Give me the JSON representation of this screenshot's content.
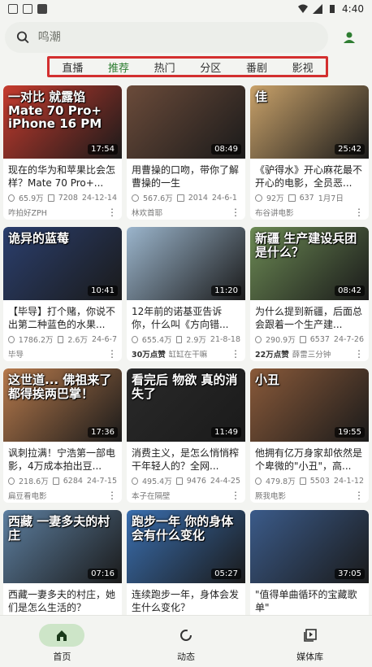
{
  "status": {
    "time": "4:40"
  },
  "search": {
    "placeholder": "鸣潮"
  },
  "tabs": [
    {
      "label": "直播",
      "active": false
    },
    {
      "label": "推荐",
      "active": true
    },
    {
      "label": "热门",
      "active": false
    },
    {
      "label": "分区",
      "active": false
    },
    {
      "label": "番剧",
      "active": false
    },
    {
      "label": "影视",
      "active": false
    }
  ],
  "videos": [
    {
      "overlay": "一对比 就露馅 Mate 70 Pro+ iPhone 16 PM",
      "duration": "17:54",
      "title": "现在的华为和苹果比会怎样？Mate 70 Pro+...",
      "views": "65.9万",
      "danmaku": "7208",
      "date": "24-12-14",
      "likes": "",
      "author": "咋拍好ZPH",
      "color": "#c63b2e"
    },
    {
      "overlay": "",
      "duration": "08:49",
      "title": "用曹操的口吻，带你了解曹操的一生",
      "views": "567.6万",
      "danmaku": "2014",
      "date": "24-6-1",
      "likes": "",
      "author": "林欢首耶",
      "color": "#6b4b3a"
    },
    {
      "overlay": "佳",
      "duration": "25:42",
      "title": "《驴得水》开心麻花最不开心的电影，全员恶...",
      "views": "92万",
      "danmaku": "637",
      "date": "1月7日",
      "likes": "",
      "author": "布谷讲电影",
      "color": "#c9a26a"
    },
    {
      "overlay": "诡异的蓝莓",
      "duration": "10:41",
      "title": "【毕导】打个赌，你说不出第二种蓝色的水果...",
      "views": "1786.2万",
      "danmaku": "2.6万",
      "date": "24-6-7",
      "likes": "",
      "author": "毕导",
      "color": "#2b3f6e"
    },
    {
      "overlay": "",
      "duration": "11:20",
      "title": "12年前的诺基亚告诉你，什么叫《方向错...",
      "views": "655.4万",
      "danmaku": "2.9万",
      "date": "21-8-18",
      "likes": "30万点赞",
      "author": "缸缸在干嘛",
      "color": "#9bb5cc"
    },
    {
      "overlay": "新疆 生产建设兵团 是什么？",
      "duration": "08:42",
      "title": "为什么提到新疆，后面总会跟着一个生产建...",
      "views": "290.9万",
      "danmaku": "6537",
      "date": "24-7-26",
      "likes": "22万点赞",
      "author": "薛雷三分钟",
      "color": "#6c8a54"
    },
    {
      "overlay": "这世道... 佛祖来了 都得挨两巴掌！",
      "duration": "17:36",
      "title": "讽刺拉满！宁浩第一部电影，4万成本拍出豆...",
      "views": "218.6万",
      "danmaku": "6284",
      "date": "24-7-15",
      "likes": "",
      "author": "扁豆看电影",
      "color": "#b77a4c"
    },
    {
      "overlay": "看完后 物欲 真的消失了",
      "duration": "11:49",
      "title": "消费主义，是怎么悄悄榨干年轻人的？全网...",
      "views": "495.4万",
      "danmaku": "9476",
      "date": "24-4-25",
      "likes": "",
      "author": "本子在隔壁",
      "color": "#2a2a2a"
    },
    {
      "overlay": "小丑",
      "duration": "19:55",
      "title": "他拥有亿万身家却依然是个卑微的\"小丑\"，高...",
      "views": "479.8万",
      "danmaku": "5503",
      "date": "24-1-12",
      "likes": "",
      "author": "厥我电影",
      "color": "#8a5a3a"
    },
    {
      "overlay": "西藏 一妻多夫的村庄",
      "duration": "07:16",
      "title": "西藏一妻多夫的村庄，她们是怎么生活的？",
      "views": "",
      "danmaku": "",
      "date": "",
      "likes": "",
      "author": "",
      "color": "#5d7fa0"
    },
    {
      "overlay": "跑步一年 你的身体 会有什么变化",
      "duration": "05:27",
      "title": "连续跑步一年，身体会发生什么变化？",
      "views": "",
      "danmaku": "",
      "date": "",
      "likes": "",
      "author": "",
      "color": "#3a6fb0"
    },
    {
      "overlay": "",
      "duration": "37:05",
      "title": "\"值得单曲循环的宝藏歌单\"",
      "views": "",
      "danmaku": "",
      "date": "",
      "likes": "",
      "author": "",
      "color": "#3b5b8a"
    }
  ],
  "nav": [
    {
      "label": "首页",
      "icon": "home-icon",
      "active": true
    },
    {
      "label": "动态",
      "icon": "dynamic-icon",
      "active": false
    },
    {
      "label": "媒体库",
      "icon": "library-icon",
      "active": false
    }
  ]
}
